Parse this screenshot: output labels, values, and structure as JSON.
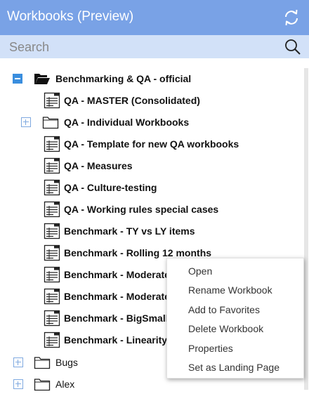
{
  "header": {
    "title": "Workbooks (Preview)",
    "refresh_icon": "refresh-icon"
  },
  "search": {
    "placeholder": "Search",
    "value": "",
    "icon": "search-icon"
  },
  "colors": {
    "header_bg": "#79a2e6",
    "search_bg": "#d2e1f8",
    "expander": "#3a8ede"
  },
  "tree": {
    "root": {
      "label": "Benchmarking & QA - official",
      "expanded": true
    },
    "children": [
      {
        "label": "QA - MASTER (Consolidated)",
        "type": "workbook"
      },
      {
        "label": "QA - Individual Workbooks",
        "type": "folder",
        "expanded": false
      },
      {
        "label": "QA - Template for new QA workbooks",
        "type": "workbook"
      },
      {
        "label": "QA - Measures",
        "type": "workbook"
      },
      {
        "label": "QA - Culture-testing",
        "type": "workbook"
      },
      {
        "label": "QA - Working rules special cases",
        "type": "workbook"
      },
      {
        "label": "Benchmark - TY vs LY items",
        "type": "workbook"
      },
      {
        "label": "Benchmark - Rolling 12 months",
        "type": "workbook"
      },
      {
        "label": "Benchmark - Moderate",
        "type": "workbook"
      },
      {
        "label": "Benchmark - Moderate",
        "type": "workbook"
      },
      {
        "label": "Benchmark - BigSmall",
        "type": "workbook"
      },
      {
        "label": "Benchmark - Linearity",
        "type": "workbook"
      }
    ],
    "siblings": [
      {
        "label": "Bugs",
        "type": "folder",
        "expanded": false
      },
      {
        "label": "Alex",
        "type": "folder",
        "expanded": false
      }
    ]
  },
  "context_menu": {
    "items": [
      "Open",
      "Rename Workbook",
      "Add to Favorites",
      "Delete Workbook",
      "Properties",
      "Set as Landing Page"
    ]
  }
}
